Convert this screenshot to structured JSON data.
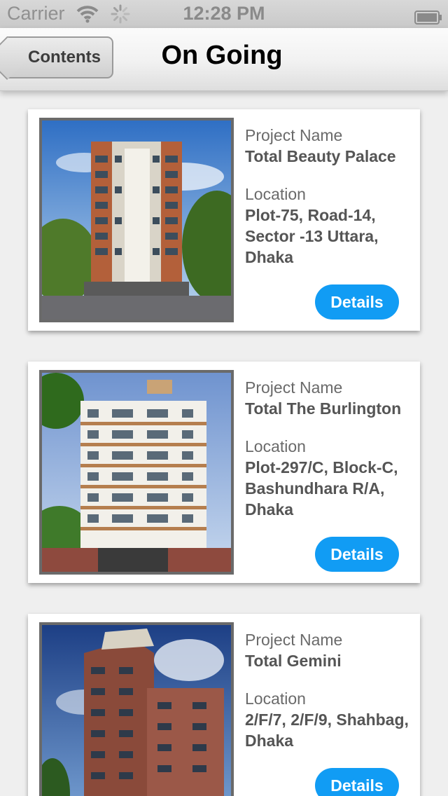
{
  "status_bar": {
    "carrier": "Carrier",
    "time": "12:28 PM",
    "icons": [
      "wifi-icon",
      "activity-spinner-icon",
      "battery-icon"
    ]
  },
  "nav": {
    "back_label": "Contents",
    "title": "On Going"
  },
  "colors": {
    "details_button": "#119cf4",
    "nav_background": "#f1f1f1",
    "page_background": "#efefef"
  },
  "projects": [
    {
      "name_label": "Project Name",
      "name": "Total Beauty Palace",
      "location_label": "Location",
      "location": [
        "Plot-75, Road-14,",
        "Sector -13 Uttara,",
        "Dhaka"
      ],
      "button": "Details",
      "image": "building-photo"
    },
    {
      "name_label": "Project Name",
      "name": "Total The Burlington",
      "location_label": "Location",
      "location": [
        "Plot-297/C, Block-C,",
        "Bashundhara R/A,",
        "Dhaka"
      ],
      "button": "Details",
      "image": "building-photo"
    },
    {
      "name_label": "Project Name",
      "name": "Total Gemini",
      "location_label": "Location",
      "location": [
        "2/F/7, 2/F/9, Shahbag,",
        "Dhaka"
      ],
      "button": "Details",
      "image": "building-photo"
    }
  ]
}
